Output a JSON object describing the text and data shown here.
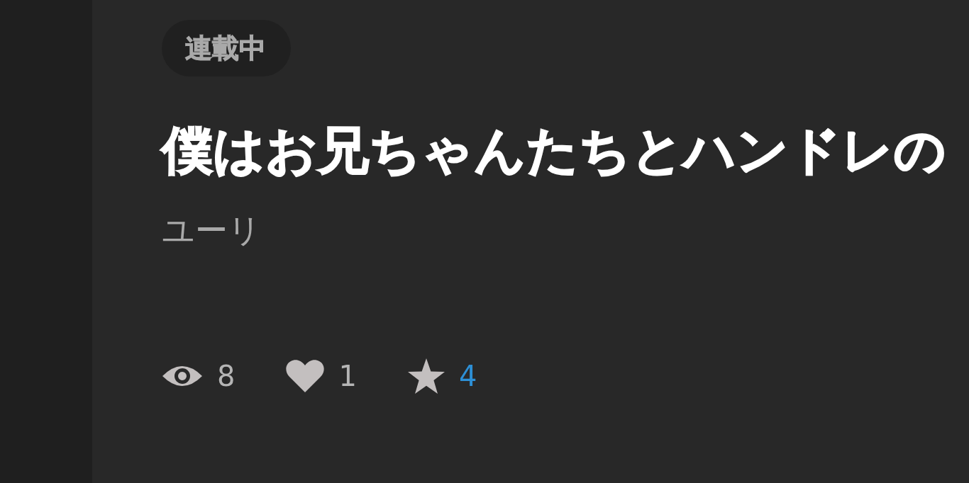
{
  "badge": {
    "label": "連載中"
  },
  "title": "僕はお兄ちゃんたちとハンドレの",
  "author": "ユーリ",
  "stats": [
    {
      "kind": "views",
      "count": "8",
      "highlighted": false
    },
    {
      "kind": "likes",
      "count": "1",
      "highlighted": false
    },
    {
      "kind": "favorites",
      "count": "4",
      "highlighted": true
    }
  ]
}
